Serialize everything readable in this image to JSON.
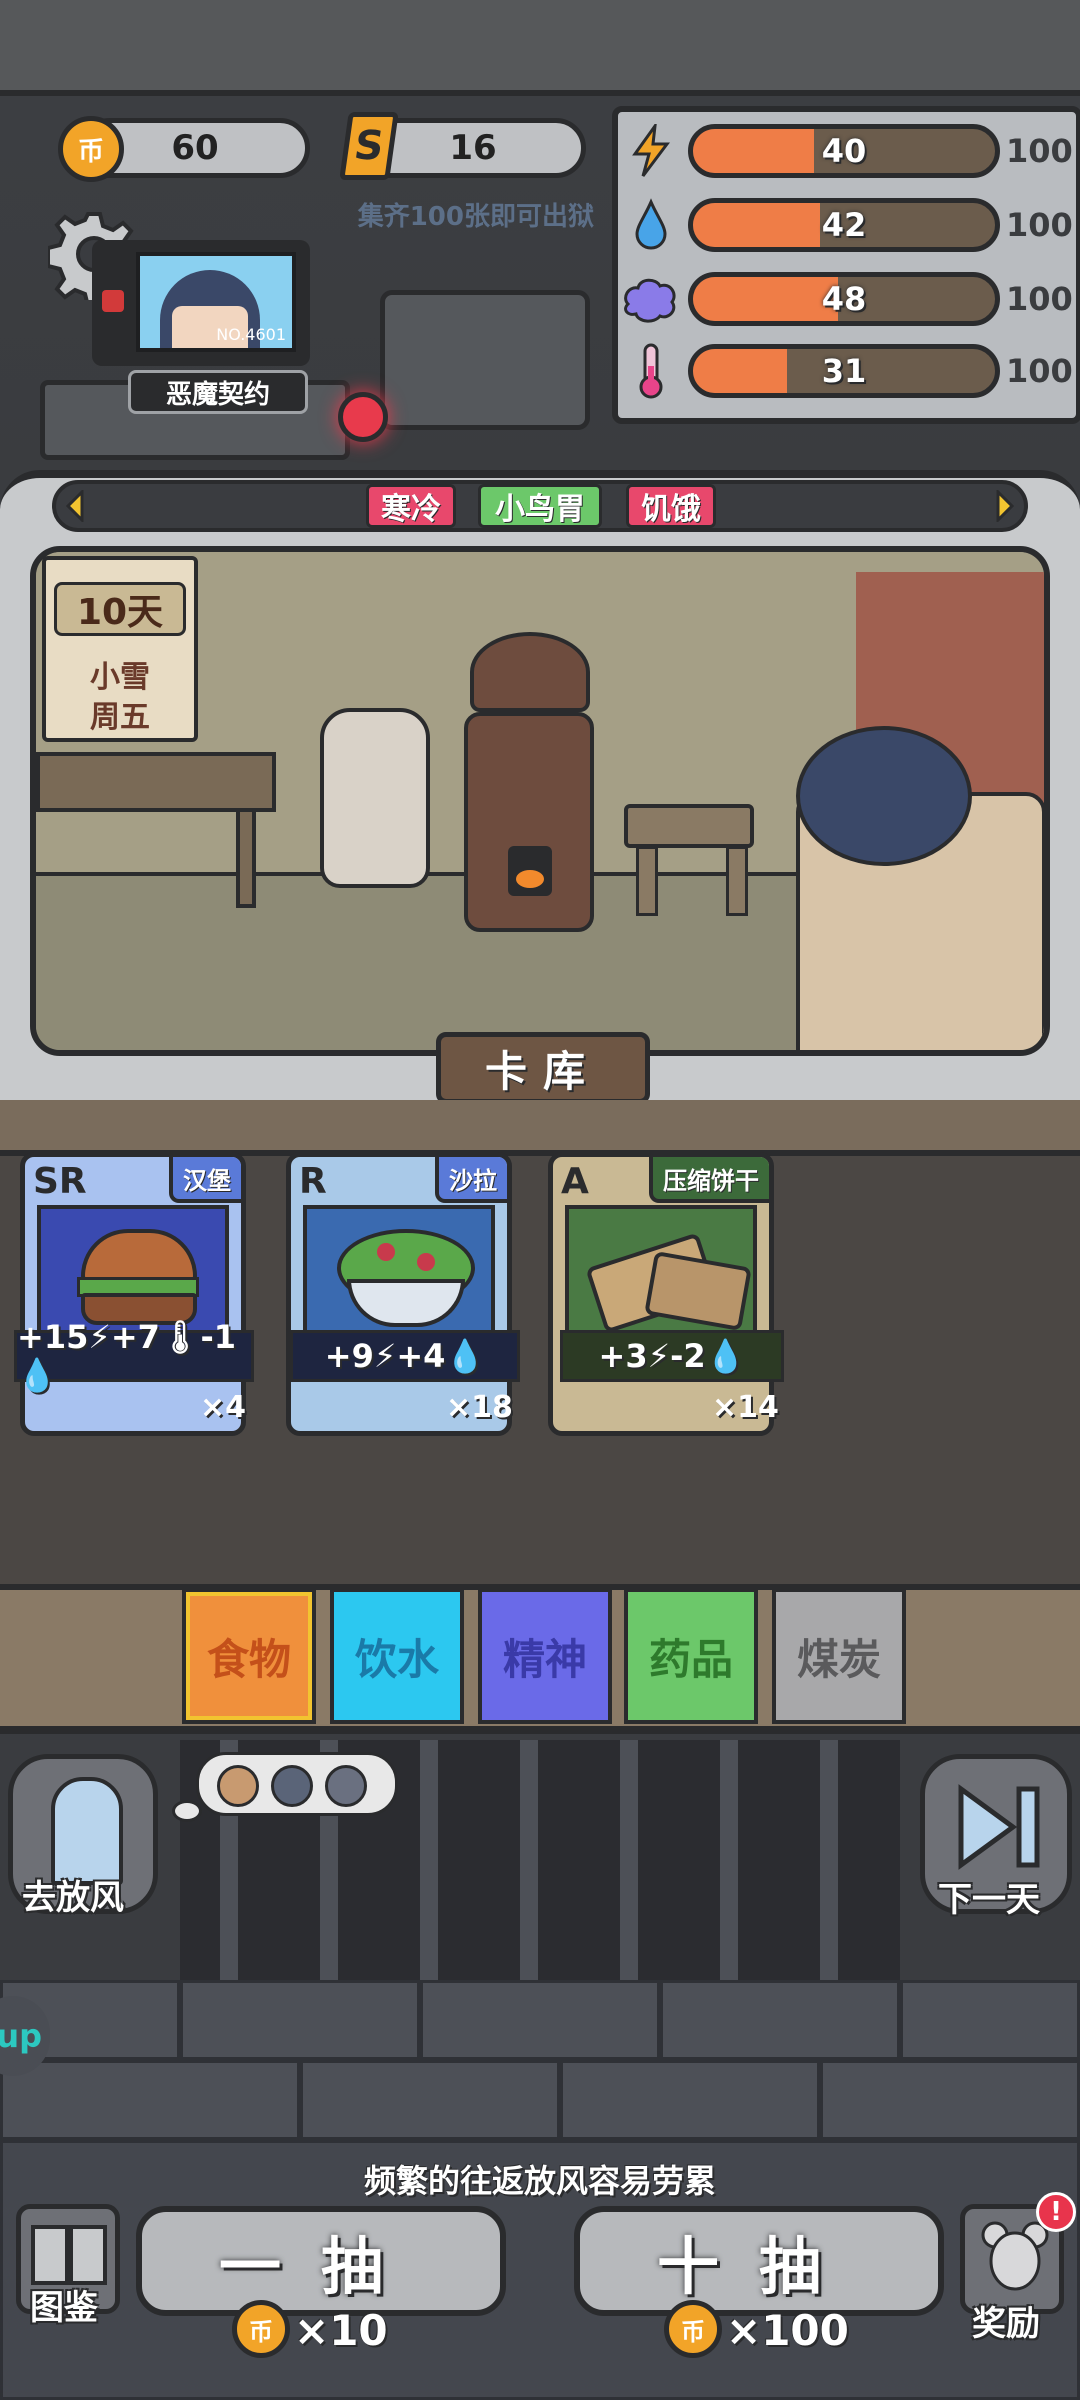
{
  "resources": {
    "coins": "60",
    "coin_icon_label": "币",
    "special_cards": "16",
    "special_icon_label": "S",
    "collect_hint": "集齐100张即可出狱"
  },
  "profile": {
    "serial": "NO.4601",
    "contract_label": "恶魔契约"
  },
  "stats": [
    {
      "icon": "energy-icon",
      "glyph": "⚡",
      "value": "40",
      "max": "100",
      "fraction": 0.4,
      "color": "#f2a428"
    },
    {
      "icon": "water-drop-icon",
      "glyph": "💧",
      "value": "42",
      "max": "100",
      "fraction": 0.42,
      "color": "#48a4e8"
    },
    {
      "icon": "brain-icon",
      "glyph": "🧠",
      "value": "48",
      "max": "100",
      "fraction": 0.48,
      "color": "#8a7be8"
    },
    {
      "icon": "thermometer-icon",
      "glyph": "🌡",
      "value": "31",
      "max": "100",
      "fraction": 0.31,
      "color": "#e8448a"
    }
  ],
  "status_tags": [
    {
      "label": "寒冷",
      "color": "#e8486c"
    },
    {
      "label": "小鸟胃",
      "color": "#6cc86a"
    },
    {
      "label": "饥饿",
      "color": "#e8486c"
    }
  ],
  "calendar": {
    "day": "10天",
    "weather": "小雪",
    "weekday": "周五"
  },
  "card_library_label": "卡库",
  "cards": [
    {
      "rank": "SR",
      "name": "汉堡",
      "effect": "+15⚡+7🌡-1💧",
      "count": "×4",
      "name_color": "#5a7ad8",
      "bg": "#a9c2f0"
    },
    {
      "rank": "R",
      "name": "沙拉",
      "effect": "+9⚡+4💧",
      "count": "×18",
      "name_color": "#5a7ad8",
      "bg": "#a9c9e8"
    },
    {
      "rank": "A",
      "name": "压缩饼干",
      "effect": "+3⚡-2💧",
      "count": "×14",
      "name_color": "#3c6a3a",
      "bg": "#c9b994"
    }
  ],
  "categories": [
    {
      "label": "食物",
      "bg": "#f0903c",
      "fg": "#c4501a",
      "active": true
    },
    {
      "label": "饮水",
      "bg": "#2cc8f0",
      "fg": "#1a7aa8",
      "active": false
    },
    {
      "label": "精神",
      "bg": "#6a6ae8",
      "fg": "#3a3aa8",
      "active": false
    },
    {
      "label": "药品",
      "bg": "#6cc86a",
      "fg": "#2e7a2c",
      "active": false
    },
    {
      "label": "煤炭",
      "bg": "#a8a8aa",
      "fg": "#5a5a5c",
      "active": false
    }
  ],
  "actions": {
    "go_out_label": "去放风",
    "next_day_label": "下一天",
    "hint": "频繁的往返放风容易劳累",
    "catalog_label": "图鉴",
    "single_draw_label": "一抽",
    "single_draw_cost": "×10",
    "ten_draw_label": "十抽",
    "ten_draw_cost": "×100",
    "reward_label": "奖励",
    "reward_badge": "!",
    "side_tab_label": "up"
  }
}
